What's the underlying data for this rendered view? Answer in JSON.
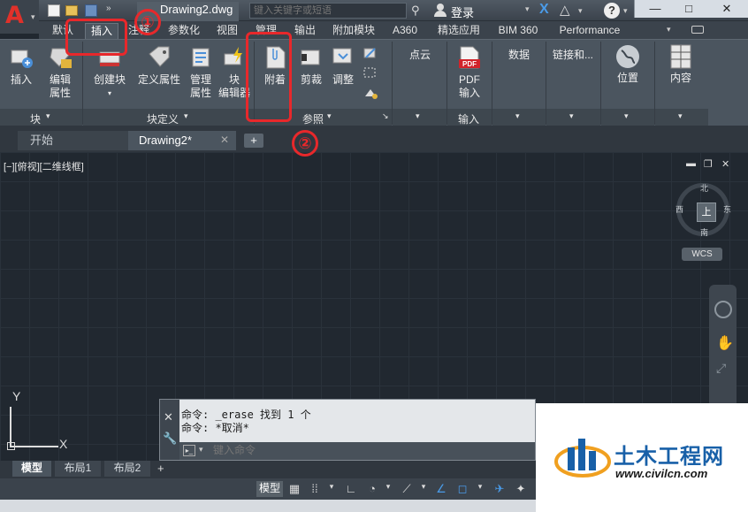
{
  "titlebar": {
    "doc_title": "Drawing2.dwg",
    "search_placeholder": "键入关键字或短语",
    "login": "登录",
    "help": "?",
    "window_minimize": "—",
    "window_restore": "□",
    "window_close": "✕"
  },
  "ribbon_tabs": [
    {
      "label": "默认"
    },
    {
      "label": "插入",
      "active": true
    },
    {
      "label": "注释"
    },
    {
      "label": "参数化"
    },
    {
      "label": "视图"
    },
    {
      "label": "管理"
    },
    {
      "label": "输出"
    },
    {
      "label": "附加模块"
    },
    {
      "label": "A360"
    },
    {
      "label": "精选应用"
    },
    {
      "label": "BIM 360"
    },
    {
      "label": "Performance"
    }
  ],
  "ribbon": {
    "block_panel": {
      "title": "块",
      "insert": "插入",
      "edit_attr": [
        "编辑",
        "属性"
      ]
    },
    "block_def_panel": {
      "title": "块定义",
      "create_block": "创建块",
      "define_attr": "定义属性",
      "manage_attr": [
        "管理",
        "属性"
      ],
      "block_editor": [
        "块",
        "编辑器"
      ]
    },
    "reference_panel": {
      "title": "参照",
      "attach": "附着",
      "clip": "剪裁",
      "adjust": "调整"
    },
    "pointcloud_panel": {
      "title": "点云"
    },
    "import_panel": {
      "title": "输入",
      "pdf_import": [
        "PDF",
        "输入"
      ],
      "pdf_badge": "PDF"
    },
    "data_panel": {
      "title": "数据"
    },
    "link_panel": {
      "title": "链接和..."
    },
    "location_panel": {
      "title": "位置"
    },
    "content_panel": {
      "title": "内容"
    }
  },
  "file_tabs": {
    "start": "开始",
    "drawing": "Drawing2*",
    "close": "✕",
    "add": "+"
  },
  "viewport": {
    "view_label": "[−][俯视][二维线框]",
    "viewcube_face": "上",
    "north": "北",
    "south": "南",
    "east": "东",
    "west": "西",
    "wcs": "WCS",
    "ucs_x": "X",
    "ucs_y": "Y"
  },
  "command": {
    "history": [
      "命令: _erase 找到 1 个",
      "命令: *取消*"
    ],
    "placeholder": "键入命令"
  },
  "layout_tabs": [
    {
      "label": "模型",
      "active": true
    },
    {
      "label": "布局1"
    },
    {
      "label": "布局2"
    }
  ],
  "statusbar": {
    "model": "模型"
  },
  "watermark": {
    "title": "土木工程网",
    "url": "www.civilcn.com"
  },
  "annotations": {
    "step1": "①",
    "step2": "②"
  },
  "colors": {
    "accent_red": "#e8282b",
    "autocad_red": "#e0312a",
    "watermark_blue": "#1860a8"
  }
}
